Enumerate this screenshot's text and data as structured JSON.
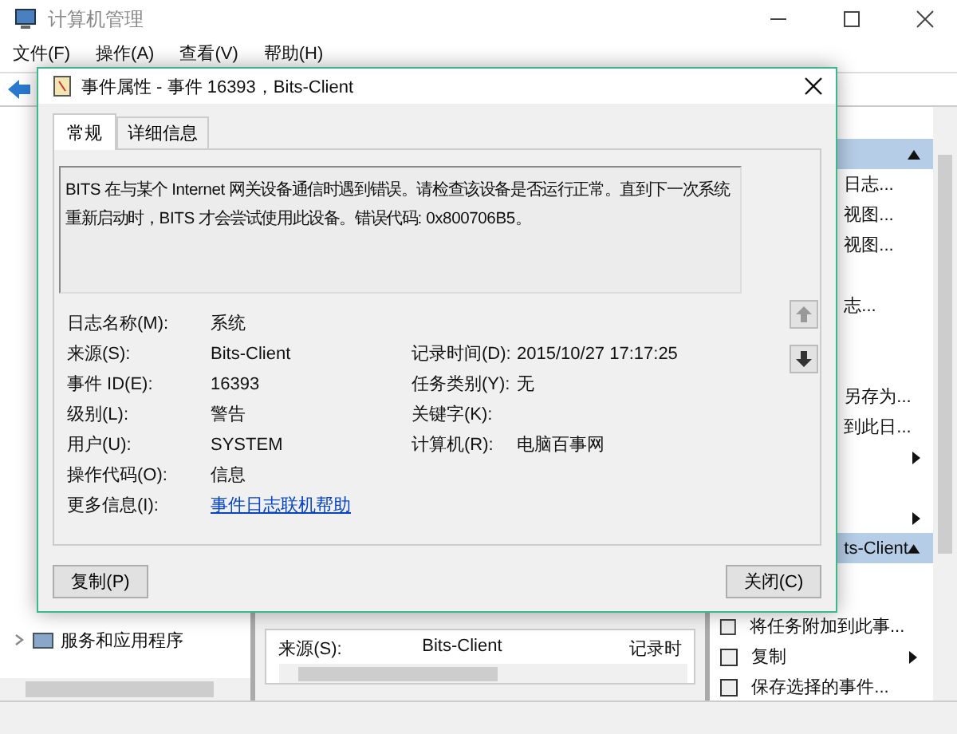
{
  "window": {
    "title": "计算机管理"
  },
  "menu": [
    "文件(F)",
    "操作(A)",
    "查看(V)",
    "帮助(H)"
  ],
  "tree": {
    "items": [
      {
        "label": "服务和应用程序",
        "expanded": false
      }
    ]
  },
  "details_preview": {
    "label": "来源(S):",
    "value": "Bits-Client",
    "label_2": "记录时"
  },
  "actions": [
    {
      "kind": "heading"
    },
    {
      "kind": "item",
      "label": "日志..."
    },
    {
      "kind": "item",
      "label": "视图..."
    },
    {
      "kind": "item",
      "label": "视图..."
    },
    {
      "kind": "item"
    },
    {
      "kind": "item",
      "label": "志..."
    },
    {
      "kind": "item"
    },
    {
      "kind": "item"
    },
    {
      "kind": "item",
      "label": "另存为..."
    },
    {
      "kind": "item",
      "label": "到此日..."
    },
    {
      "kind": "submenu"
    },
    {
      "kind": "item"
    },
    {
      "kind": "submenu"
    },
    {
      "kind": "heading",
      "label": "ts-Client"
    }
  ],
  "actions_below": [
    {
      "kind": "item",
      "label": "将任务附加到此事..."
    },
    {
      "kind": "submenu",
      "label": "复制"
    },
    {
      "kind": "item",
      "label": "保存选择的事件..."
    }
  ],
  "dialog": {
    "title": "事件属性 - 事件 16393，Bits-Client",
    "tabs": [
      {
        "label": "常规",
        "selected": true
      },
      {
        "label": "详细信息",
        "selected": false
      }
    ],
    "description": "BITS 在与某个 Internet 网关设备通信时遇到错误。请检查该设备是否运行正常。直到下一次系统重新启动时，BITS 才会尝试使用此设备。错误代码: 0x800706B5。",
    "fields": [
      {
        "label": "日志名称(M):",
        "value": "系统"
      },
      {
        "label": "来源(S):",
        "value": "Bits-Client",
        "label_2": "记录时间(D):",
        "value_2": "2015/10/27 17:17:25"
      },
      {
        "label": "事件 ID(E):",
        "value": "16393",
        "label_2": "任务类别(Y):",
        "value_2": "无"
      },
      {
        "label": "级别(L):",
        "value": "警告",
        "label_2": "关键字(K):"
      },
      {
        "label": "用户(U):",
        "value": "SYSTEM",
        "label_2": "计算机(R):",
        "value_2": "电脑百事网"
      },
      {
        "label": "操作代码(O):",
        "value": "信息"
      },
      {
        "label": "更多信息(I):",
        "link": "事件日志联机帮助"
      }
    ],
    "buttons": [
      {
        "label": "复制(P)"
      },
      {
        "label": "关闭(C)"
      }
    ]
  }
}
